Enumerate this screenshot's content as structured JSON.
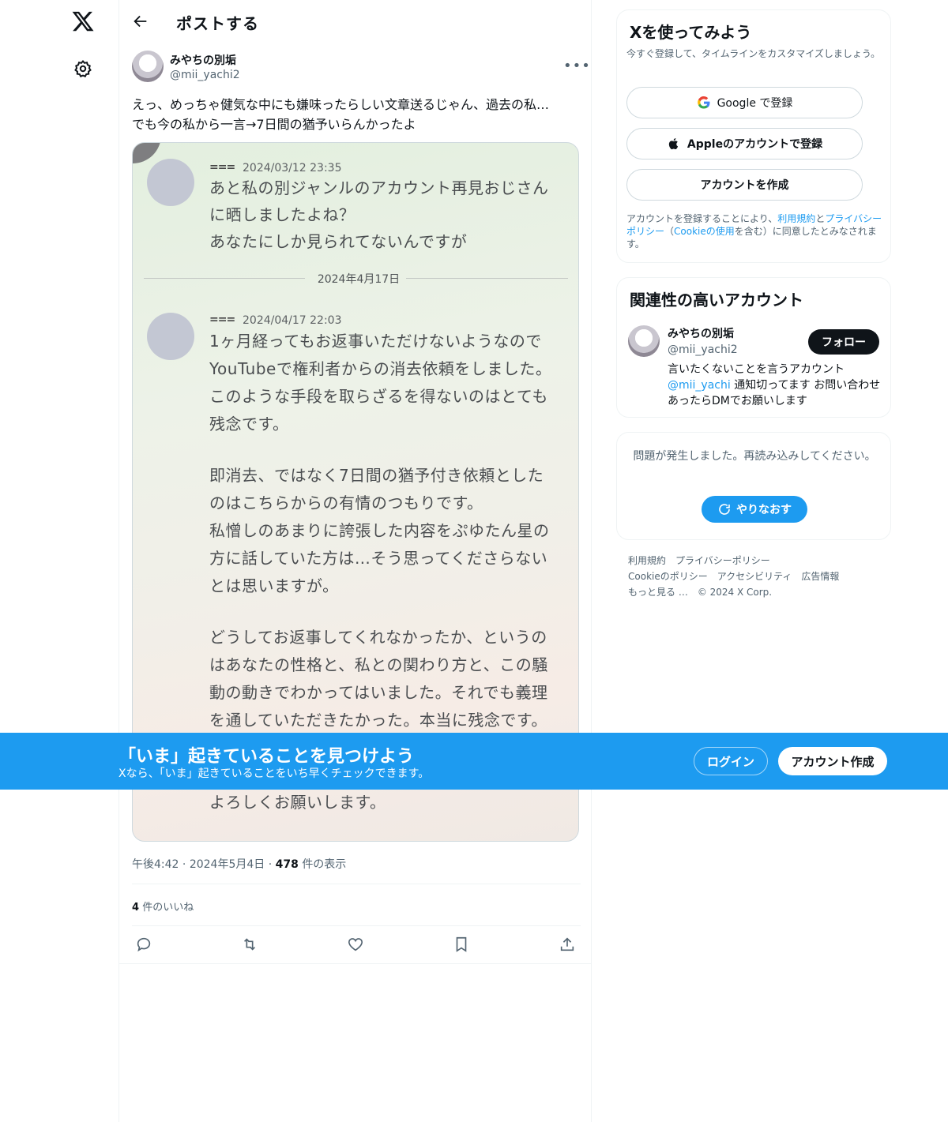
{
  "header": {
    "title": "ポストする"
  },
  "post": {
    "author_name": "みやちの別垢",
    "author_handle": "@mii_yachi2",
    "text_line1": "えっ、めっちゃ健気な中にも嫌味ったらしい文章送るじゃん、過去の私…",
    "text_line2": "でも今の私から一言→7日間の猶予いらんかったよ",
    "time": "午後4:42",
    "date": "2024年5月4日",
    "views_count": "478",
    "views_label": "件の表示",
    "likes_count": "4",
    "likes_label": "件のいいね"
  },
  "screenshot": {
    "msg1_sender": "===",
    "msg1_time": "2024/03/12 23:35",
    "msg1_lines": [
      "あと私の別ジャンルのアカウント再見おじさん",
      "に晒しましたよね？",
      "あなたにしか見られてないんですが"
    ],
    "divider_date": "2024年4月17日",
    "msg2_sender": "===",
    "msg2_time": "2024/04/17 22:03",
    "msg2_lines": [
      "1ヶ月経ってもお返事いただけないようなので",
      "YouTubeで権利者からの消去依頼をしました。",
      "このような手段を取らざるを得ないのはとても",
      "残念です。",
      "即消去、ではなく7日間の猶予付き依頼とした",
      "のはこちらからの有情のつもりです。",
      "私憎しのあまりに誇張した内容をぷゆたん星の",
      "方に話していた方は…そう思ってくださらない",
      "とは思いますが。",
      "どうしてお返事してくれなかったか、というの",
      "はあなたの性格と、私との関わり方と、この騒",
      "動の動きでわかってはいました。それでも義理",
      "を通していただきたかった。本当に残念です。",
      "よろしくお願いします。"
    ]
  },
  "signup": {
    "title": "Xを使ってみよう",
    "subtitle": "今すぐ登録して、タイムラインをカスタマイズしましょう。",
    "google_label": "Google で登録",
    "apple_label": "Appleのアカウントで登録",
    "create_label": "アカウントを作成",
    "legal_1": "アカウントを登録することにより、",
    "legal_terms": "利用規約",
    "legal_2": "と",
    "legal_privacy": "プライバシーポリシー",
    "legal_3": "（",
    "legal_cookie": "Cookieの使用",
    "legal_4": "を含む）に同意したとみなされます。"
  },
  "relevant": {
    "title": "関連性の高いアカウント",
    "name": "みやちの別垢",
    "handle": "@mii_yachi2",
    "follow_label": "フォロー",
    "bio_1": "言いたくないことを言うアカウント",
    "bio_mention": "@mii_yachi",
    "bio_2": " 通知切ってます お問い合わせあったらDMでお願いします"
  },
  "error_card": {
    "message": "問題が発生しました。再読み込みしてください。",
    "retry_label": "やりなおす"
  },
  "footer": {
    "terms": "利用規約",
    "privacy": "プライバシーポリシー",
    "cookie": "Cookieのポリシー",
    "accessibility": "アクセシビリティ",
    "ads": "広告情報",
    "more": "もっと見る …",
    "copyright": "© 2024 X Corp."
  },
  "banner": {
    "title": "「いま」起きていることを見つけよう",
    "subtitle": "Xなら、「いま」起きていることをいち早くチェックできます。",
    "login_label": "ログイン",
    "signup_label": "アカウント作成"
  },
  "colors": {
    "accent": "#1d9bf0",
    "text": "#0f1419",
    "secondary": "#536471"
  }
}
